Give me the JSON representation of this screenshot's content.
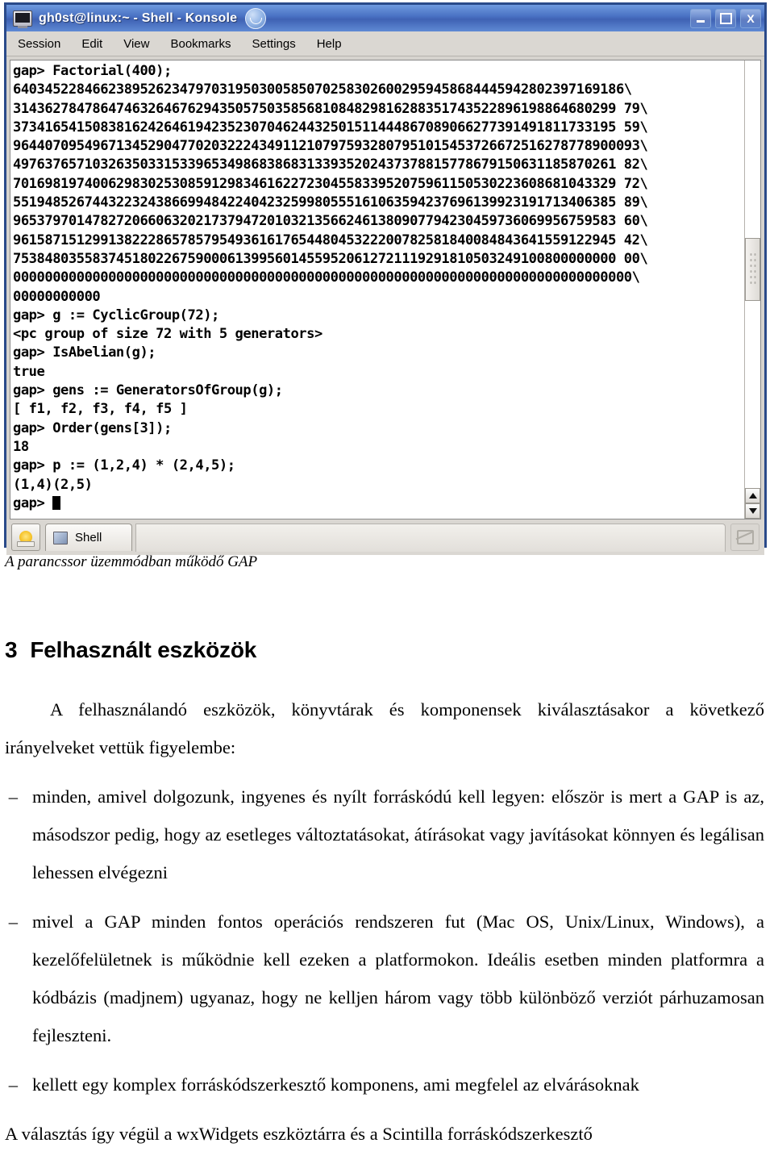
{
  "window": {
    "title": "gh0st@linux:~ - Shell - Konsole",
    "icon": "terminal-icon",
    "badge_icon": "konsole-logo-icon",
    "buttons": {
      "minimize": "minimize-icon",
      "maximize": "maximize-icon",
      "close": "X"
    },
    "menubar": [
      "Session",
      "Edit",
      "View",
      "Bookmarks",
      "Settings",
      "Help"
    ],
    "tab": {
      "new_tab_icon": "new-session-icon",
      "label": "Shell",
      "right_button_icon": "close-session-icon"
    },
    "scrollbar": {
      "up_arrow": "scroll-up-icon",
      "down_arrow": "scroll-down-icon"
    }
  },
  "terminal": {
    "lines": [
      "gap> Factorial(400);",
      "64034522846623895262347970319503005850702583026002959458684445942802397169186\\",
      "3143627847864746326467629435057503585681084829816288351743522896198864680299 79\\",
      "3734165415083816242646194235230704624432501511444867089066277391491811733195 59\\",
      "9644070954967134529047702032224349112107975932807951015453726672516278778900093\\",
      "4976376571032635033153396534986838683133935202437378815778679150631185870261 82\\",
      "7016981974006298302530859129834616227230455833952075961150530223608681043329 72\\",
      "5519485267443223243866994842240423259980555161063594237696139923191713406385 89\\",
      "9653797014782720660632021737947201032135662461380907794230459736069956759583 60\\",
      "9615871512991382228657857954936161765448045322200782581840084843641559122945 42\\",
      "7538480355837451802267590006139956014559520612721119291810503249100800000000 00\\",
      "000000000000000000000000000000000000000000000000000000000000000000000000000000\\",
      "00000000000",
      "gap> g := CyclicGroup(72);",
      "<pc group of size 72 with 5 generators>",
      "gap> IsAbelian(g);",
      "true",
      "gap> gens := GeneratorsOfGroup(g);",
      "[ f1, f2, f3, f4, f5 ]",
      "gap> Order(gens[3]);",
      "18",
      "gap> p := (1,2,4) * (2,4,5);",
      "(1,4)(2,5)"
    ],
    "prompt": "gap> "
  },
  "document": {
    "figure_caption": "A parancssor üzemmódban működő GAP",
    "heading": {
      "number": "3",
      "title": "Felhasznált eszközök"
    },
    "intro": "A felhasználandó eszközök, könyvtárak és komponensek kiválasztásakor a következő irányelveket vettük figyelembe:",
    "bullet_marker": "–",
    "bullets": [
      "minden, amivel dolgozunk, ingyenes és nyílt forráskódú kell legyen: először is mert a GAP is az, másodszor pedig, hogy az esetleges változtatásokat, átírásokat vagy javításokat könnyen és legálisan lehessen elvégezni",
      "mivel a GAP minden fontos operációs rendszeren fut (Mac OS, Unix/Linux, Windows), a kezelőfelületnek is működnie kell ezeken a platformokon. Ideális esetben minden platformra a kódbázis (madjnem) ugyanaz, hogy ne kelljen három vagy több különböző verziót párhuzamosan fejleszteni.",
      "kellett egy komplex forráskódszerkesztő komponens, ami megfelel az elvárásoknak"
    ],
    "closing": "A választás így végül a wxWidgets eszköztárra és a Scintilla forráskódszerkesztő"
  }
}
